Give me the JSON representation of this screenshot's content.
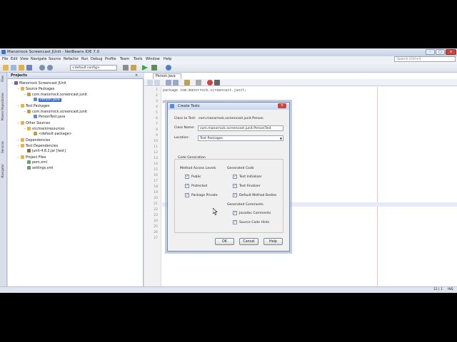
{
  "window": {
    "title": "Manorrock Screencast JUnit - NetBeans IDE 7.0",
    "min_label": "–",
    "max_label": "□",
    "close_label": "×"
  },
  "menu": [
    "File",
    "Edit",
    "View",
    "Navigate",
    "Source",
    "Refactor",
    "Run",
    "Debug",
    "Profile",
    "Team",
    "Tools",
    "Window",
    "Help"
  ],
  "search": {
    "placeholder": "Search (Ctrl+I)"
  },
  "toolbar": {
    "config_combo": "<default config>"
  },
  "side_tabs": [
    "Files",
    "Maven Repositories",
    "Services",
    "Navigator"
  ],
  "projects": {
    "header": "Projects",
    "tree": [
      {
        "label": "Manorrock Screencast JUnit",
        "indent": 0,
        "icon": "project-icon",
        "selected": false
      },
      {
        "label": "Source Packages",
        "indent": 1,
        "icon": "folder-icon",
        "selected": false
      },
      {
        "label": "com.manorrock.screencast.junit",
        "indent": 2,
        "icon": "package-icon",
        "selected": false
      },
      {
        "label": "Person.java",
        "indent": 3,
        "icon": "java-file-icon",
        "selected": true
      },
      {
        "label": "Test Packages",
        "indent": 1,
        "icon": "folder-icon",
        "selected": false
      },
      {
        "label": "com.manorrock.screencast.junit",
        "indent": 2,
        "icon": "package-icon",
        "selected": false
      },
      {
        "label": "PersonTest.java",
        "indent": 3,
        "icon": "java-file-icon",
        "selected": false
      },
      {
        "label": "Other Sources",
        "indent": 1,
        "icon": "folder-icon",
        "selected": false
      },
      {
        "label": "src/main/resources",
        "indent": 2,
        "icon": "folder-icon",
        "selected": false
      },
      {
        "label": "<default package>",
        "indent": 3,
        "icon": "package-icon",
        "selected": false
      },
      {
        "label": "Dependencies",
        "indent": 1,
        "icon": "folder-icon",
        "selected": false
      },
      {
        "label": "Test Dependencies",
        "indent": 1,
        "icon": "folder-icon",
        "selected": false
      },
      {
        "label": "junit-4.8.2.jar  [test]",
        "indent": 2,
        "icon": "jar-icon",
        "selected": false
      },
      {
        "label": "Project Files",
        "indent": 1,
        "icon": "folder-icon",
        "selected": false
      },
      {
        "label": "pom.xml",
        "indent": 2,
        "icon": "xml-file-icon",
        "selected": false
      },
      {
        "label": "settings.xml",
        "indent": 2,
        "icon": "xml-file-icon",
        "selected": false
      }
    ]
  },
  "editor": {
    "tab": "Person.java",
    "line_numbers": [
      "1",
      "2",
      "3",
      "4",
      "5",
      "6",
      "7",
      "8",
      "9",
      "10",
      "11",
      "12",
      "13",
      "14",
      "15",
      "16",
      "17",
      "18",
      "19",
      "20",
      "21",
      "22",
      "23",
      "24",
      "25",
      "26",
      "27"
    ],
    "code_line_1": "package com.manorrock.screencast.junit;",
    "code_line_3": "p"
  },
  "status": {
    "position": "12 | 1",
    "mode": "INS"
  },
  "dialog": {
    "title": "Create Tests",
    "class_to_test_label": "Class to Test:",
    "class_to_test_value": "com.manorrock.screencast.junit.Person",
    "class_name_label": "Class Name:",
    "class_name_value": "com.manorrock.screencast.junit.PersonTest",
    "location_label": "Location:",
    "location_value": "Test Packages",
    "code_generation_label": "Code Generation",
    "method_access_label": "Method Access Levels",
    "generated_code_label": "Generated Code",
    "generated_comments_label": "Generated Comments",
    "access": [
      {
        "label": "Public",
        "checked": true
      },
      {
        "label": "Protected",
        "checked": true
      },
      {
        "label": "Package Private",
        "checked": true
      }
    ],
    "generated_code": [
      {
        "label": "Test Initializer",
        "checked": true
      },
      {
        "label": "Test Finalizer",
        "checked": true
      },
      {
        "label": "Default Method Bodies",
        "checked": true
      }
    ],
    "comments": [
      {
        "label": "Javadoc Comments",
        "checked": true
      },
      {
        "label": "Source Code Hints",
        "checked": true
      }
    ],
    "ok": "OK",
    "cancel": "Cancel",
    "help": "Help",
    "check_mark": "✓"
  },
  "colors": {
    "selection": "#3a6bd1",
    "dialog_border": "#7a8aa6",
    "close_button": "#c9463d"
  }
}
